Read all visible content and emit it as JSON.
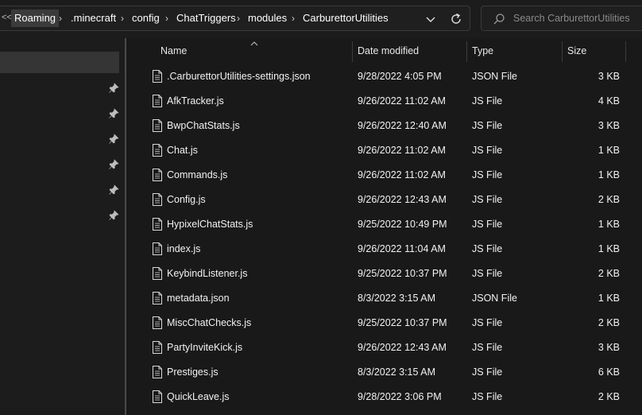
{
  "address_bar": {
    "overflow_glyph": "<<",
    "crumbs": [
      "Roaming",
      ".minecraft",
      "config",
      "ChatTriggers",
      "modules",
      "CarburettorUtilities"
    ]
  },
  "search": {
    "placeholder": "Search CarburettorUtilities"
  },
  "columns": {
    "name": "Name",
    "date": "Date modified",
    "type": "Type",
    "size": "Size"
  },
  "files": [
    {
      "name": ".CarburettorUtilities-settings.json",
      "date": "9/28/2022 4:05 PM",
      "type": "JSON File",
      "size": "3 KB"
    },
    {
      "name": "AfkTracker.js",
      "date": "9/26/2022 11:02 AM",
      "type": "JS File",
      "size": "4 KB"
    },
    {
      "name": "BwpChatStats.js",
      "date": "9/26/2022 12:40 AM",
      "type": "JS File",
      "size": "3 KB"
    },
    {
      "name": "Chat.js",
      "date": "9/26/2022 11:02 AM",
      "type": "JS File",
      "size": "1 KB"
    },
    {
      "name": "Commands.js",
      "date": "9/26/2022 11:02 AM",
      "type": "JS File",
      "size": "1 KB"
    },
    {
      "name": "Config.js",
      "date": "9/26/2022 12:43 AM",
      "type": "JS File",
      "size": "2 KB"
    },
    {
      "name": "HypixelChatStats.js",
      "date": "9/25/2022 10:49 PM",
      "type": "JS File",
      "size": "1 KB"
    },
    {
      "name": "index.js",
      "date": "9/26/2022 11:04 AM",
      "type": "JS File",
      "size": "1 KB"
    },
    {
      "name": "KeybindListener.js",
      "date": "9/25/2022 10:37 PM",
      "type": "JS File",
      "size": "2 KB"
    },
    {
      "name": "metadata.json",
      "date": "8/3/2022 3:15 AM",
      "type": "JSON File",
      "size": "1 KB"
    },
    {
      "name": "MiscChatChecks.js",
      "date": "9/25/2022 10:37 PM",
      "type": "JS File",
      "size": "2 KB"
    },
    {
      "name": "PartyInviteKick.js",
      "date": "9/26/2022 12:43 AM",
      "type": "JS File",
      "size": "3 KB"
    },
    {
      "name": "Prestiges.js",
      "date": "8/3/2022 3:15 AM",
      "type": "JS File",
      "size": "6 KB"
    },
    {
      "name": "QuickLeave.js",
      "date": "9/28/2022 3:06 PM",
      "type": "JS File",
      "size": "2 KB"
    }
  ],
  "icons": {
    "file": "file-icon",
    "pin": "pin-icon",
    "search": "search-icon",
    "refresh": "refresh-icon",
    "dropdown": "chevron-down-icon",
    "sort": "sort-up-icon"
  },
  "colors": {
    "background": "#191919",
    "selected": "#353535",
    "text": "#ffffff",
    "muted": "#8a8a8a"
  }
}
